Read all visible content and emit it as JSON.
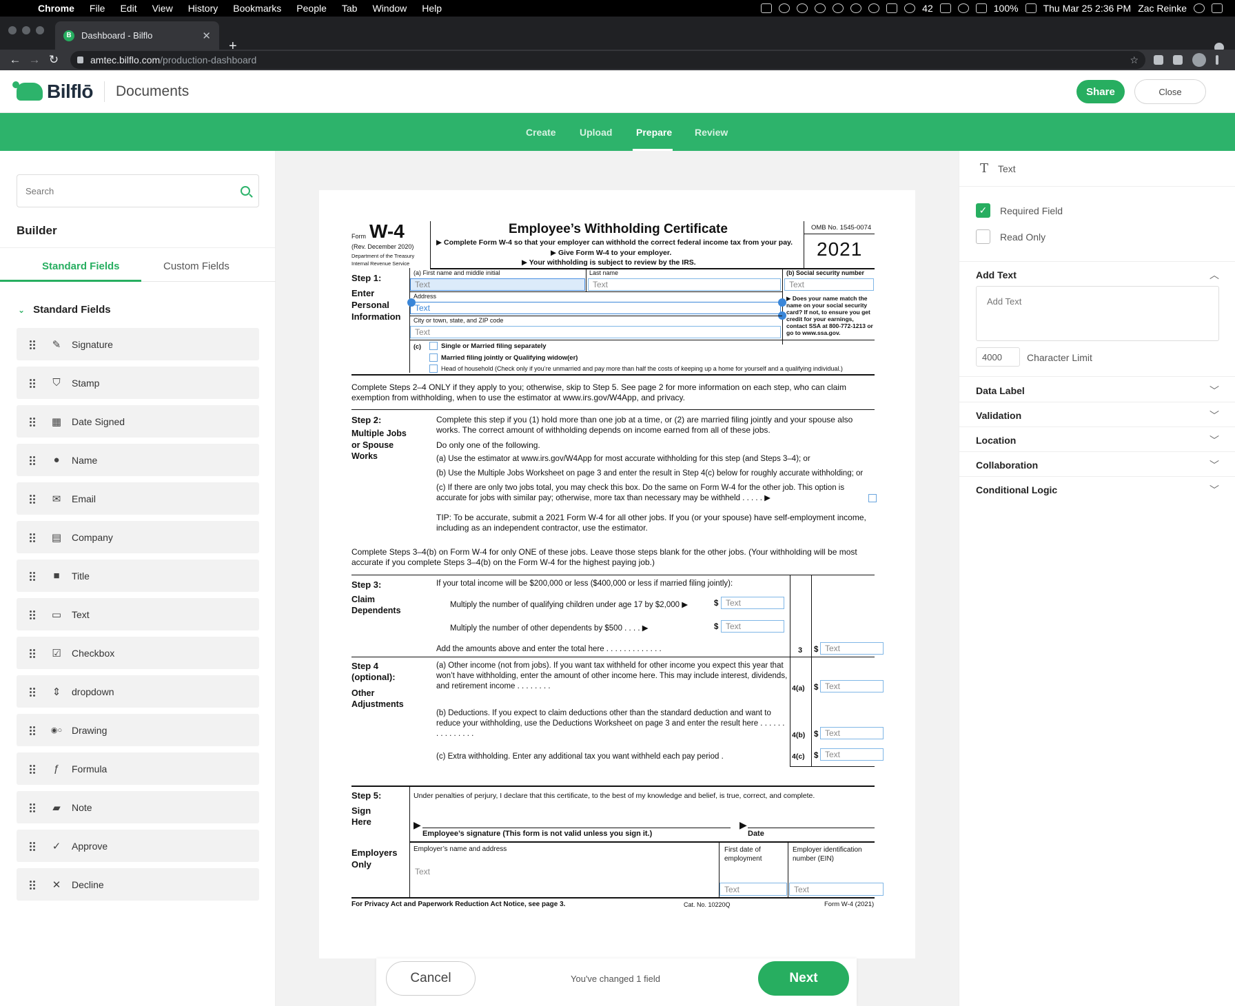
{
  "menubar": {
    "app": "Chrome",
    "items": [
      "File",
      "Edit",
      "View",
      "History",
      "Bookmarks",
      "People",
      "Tab",
      "Window",
      "Help"
    ],
    "temp": "42",
    "battery": "100%",
    "datetime": "Thu Mar 25  2:36 PM",
    "user": "Zac Reinke"
  },
  "browser": {
    "tab_title": "Dashboard - Bilflo",
    "tab_favicon_letter": "B",
    "url_host": "amtec.bilflo.com",
    "url_path": "/production-dashboard"
  },
  "header": {
    "logo": "Bilflō",
    "title": "Documents",
    "share": "Share",
    "close": "Close"
  },
  "steps": [
    "Create",
    "Upload",
    "Prepare",
    "Review"
  ],
  "left": {
    "search_placeholder": "Search",
    "builder": "Builder",
    "tabs": [
      "Standard Fields",
      "Custom Fields"
    ],
    "section": "Standard Fields",
    "fields": [
      {
        "label": "Signature",
        "icon": "✎"
      },
      {
        "label": "Stamp",
        "icon": "⛉"
      },
      {
        "label": "Date Signed",
        "icon": "▦"
      },
      {
        "label": "Name",
        "icon": "●"
      },
      {
        "label": "Email",
        "icon": "✉"
      },
      {
        "label": "Company",
        "icon": "▤"
      },
      {
        "label": "Title",
        "icon": "■"
      },
      {
        "label": "Text",
        "icon": "▭"
      },
      {
        "label": "Checkbox",
        "icon": "☑"
      },
      {
        "label": "dropdown",
        "icon": "⇕"
      },
      {
        "label": "Drawing",
        "icon": "◉○"
      },
      {
        "label": "Formula",
        "icon": "ƒ"
      },
      {
        "label": "Note",
        "icon": "▰"
      },
      {
        "label": "Approve",
        "icon": "✓"
      },
      {
        "label": "Decline",
        "icon": "✕"
      }
    ]
  },
  "w4": {
    "form_word": "Form",
    "form_no": "W-4",
    "rev": "(Rev. December 2020)",
    "dept": "Department of the Treasury",
    "irs": "Internal Revenue Service",
    "title": "Employee’s Withholding Certificate",
    "sub1": "▶ Complete Form W-4 so that your employer can withhold the correct federal income tax from your pay.",
    "sub2": "▶ Give Form W-4 to your employer.",
    "sub3": "▶ Your withholding is subject to review by the IRS.",
    "omb": "OMB No. 1545-0074",
    "year": "2021",
    "step1_label": "Step 1:",
    "step1_desc": "Enter Personal Information",
    "first_name_lbl": "(a)   First name and middle initial",
    "last_name_lbl": "Last name",
    "ssn_lbl": "(b)   Social security number",
    "address_lbl": "Address",
    "city_lbl": "City or town, state, and ZIP code",
    "ssn_note": "▶ Does your name match the name on your social security card? If not, to ensure you get credit for your earnings, contact SSA at 800-772-1213 or go to www.ssa.gov.",
    "c_lbl": "(c)",
    "filing1": "Single or Married filing separately",
    "filing2": "Married filing jointly or Qualifying widow(er)",
    "filing3": "Head of household (Check only if you’re unmarried and pay more than half the costs of keeping up a home for yourself and a qualifying individual.)",
    "complete24": "Complete Steps 2–4 ONLY if they apply to you; otherwise, skip to Step 5. See page 2 for more information on each step, who can claim exemption from withholding, when to use the estimator at www.irs.gov/W4App, and privacy.",
    "step2_label": "Step 2:",
    "step2_desc": "Multiple Jobs or Spouse Works",
    "step2_p1": "Complete this step if you (1) hold more than one job at a time, or (2) are married filing jointly and your spouse also works. The correct amount of withholding depends on income earned from all of these jobs.",
    "step2_p2": "Do only one of the following.",
    "step2_a": "(a)  Use the estimator at www.irs.gov/W4App for most accurate withholding for this step (and Steps 3–4); or",
    "step2_b": "(b)  Use the Multiple Jobs Worksheet on page 3 and enter the result in Step 4(c) below for roughly accurate withholding; or",
    "step2_c": "(c)  If there are only two jobs total, you may check this box. Do the same on Form W-4 for the other job. This option is accurate for jobs with similar pay; otherwise, more tax than necessary may be withheld . . . . . ▶",
    "tip": "TIP: To be accurate, submit a 2021 Form W-4 for all other jobs. If you (or your spouse) have self-employment income, including as an independent contractor, use the estimator.",
    "complete34": "Complete Steps 3–4(b) on Form W-4 for only ONE of these jobs. Leave those steps blank for the other jobs. (Your withholding will be most accurate if you complete Steps 3–4(b) on the Form W-4 for the highest paying job.)",
    "step3_label": "Step 3:",
    "step3_desc": "Claim Dependents",
    "step3_intro": "If your total income will be $200,000 or less ($400,000 or less if married filing jointly):",
    "step3_l1": "Multiply the number of qualifying children under age 17 by $2,000 ▶",
    "step3_l2": "Multiply the number of other dependents by $500     .   .   .   .   ▶",
    "step3_total": "Add the amounts above and enter the total here   .   .   .   .   .   .   .   .   .   .   .   .   .",
    "line3": "3",
    "step4_label": "Step 4 (optional):",
    "step4_desc": "Other Adjustments",
    "step4_a": "(a)  Other income (not from jobs). If you want tax withheld for other income you expect this year that won’t have withholding, enter the amount of other income here. This may include interest, dividends, and retirement income   .   .   .   .   .   .   .   .",
    "step4_b": "(b)  Deductions. If you expect to claim deductions other than the standard deduction and want to reduce your withholding, use the Deductions Worksheet on page 3 and enter the result here   .   .   .   .   .   .   .   .   .   .   .   .   .   .   .",
    "step4_c": "(c)  Extra withholding. Enter any additional tax you want withheld each pay period   .",
    "line4a": "4(a)",
    "line4b": "4(b)",
    "line4c": "4(c)",
    "dollar": "$",
    "step5_label": "Step 5:",
    "step5_desc": "Sign Here",
    "perjury": "Under penalties of perjury, I declare that this certificate, to the best of my knowledge and belief, is true, correct, and complete.",
    "sig_lbl": "Employee’s signature (This form is not valid unless you sign it.)",
    "date_lbl": "Date",
    "employers": "Employers Only",
    "emp_name_lbl": "Employer’s name and address",
    "first_date_lbl": "First date of employment",
    "ein_lbl": "Employer identification number (EIN)",
    "footer_left": "For Privacy Act and Paperwork Reduction Act Notice, see page 3.",
    "footer_cat": "Cat. No. 10220Q",
    "footer_right": "Form W-4 (2021)",
    "field_text": "Text"
  },
  "bottom": {
    "cancel": "Cancel",
    "changed": "You've changed 1 field",
    "next": "Next"
  },
  "right": {
    "type": "Text",
    "required": "Required Field",
    "readonly": "Read Only",
    "add_text": "Add Text",
    "add_text_placeholder": "Add Text",
    "char_limit_value": "4000",
    "char_limit": "Character Limit",
    "sections": [
      "Data Label",
      "Validation",
      "Location",
      "Collaboration",
      "Conditional Logic"
    ]
  },
  "colors": {
    "brand_green": "#2db36b",
    "button_green": "#27ae60",
    "field_blue": "#7fb6e6"
  }
}
